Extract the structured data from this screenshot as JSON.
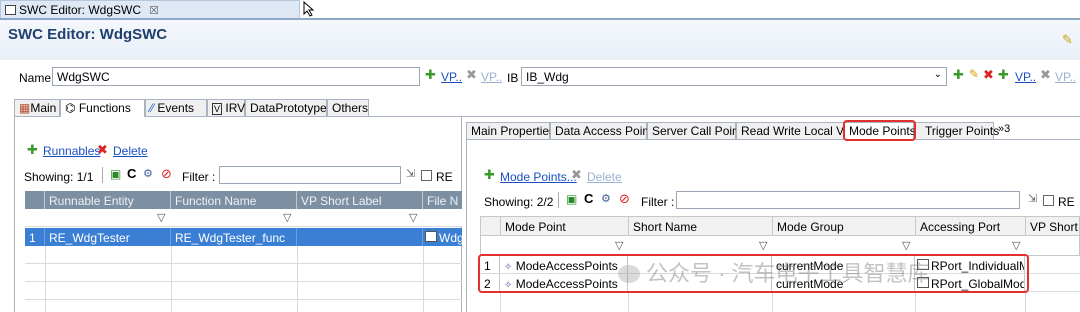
{
  "editor_tab": {
    "title": "SWC Editor: WdgSWC",
    "close": "☒"
  },
  "title": "SWC Editor: WdgSWC",
  "name_row": {
    "name_label": "Name",
    "name_value": "WdgSWC",
    "vp_link": "VP..",
    "vp_link_disabled": "VP..",
    "ib_label": "IB",
    "ib_value": "IB_Wdg",
    "vp_link2": "VP..",
    "vp_link2_disabled": "VP.."
  },
  "main_tabs": [
    "Main",
    "Functions",
    "Events",
    "IRV",
    "DataPrototypes",
    "Others"
  ],
  "left": {
    "runnables_link": "Runnables",
    "delete_link": "Delete",
    "showing": "Showing: 1/1",
    "filter_label": "Filter :",
    "re_label": "RE",
    "columns": [
      "Runnable Entity",
      "Function Name",
      "VP Short Label",
      "File N"
    ],
    "rows": [
      {
        "num": "1",
        "runnable": "RE_WdgTester",
        "function": "RE_WdgTester_func",
        "vp": "",
        "file": "WdgS"
      }
    ]
  },
  "right_tabs": [
    "Main Properties",
    "Data Access Points",
    "Server Call Points",
    "Read Write Local Var",
    "Mode Points",
    "Trigger Points",
    "»3"
  ],
  "right": {
    "mode_points_link": "Mode Points...",
    "delete_link": "Delete",
    "showing": "Showing: 2/2",
    "filter_label": "Filter :",
    "re_label": "RE",
    "columns": [
      "Mode Point",
      "Short Name",
      "Mode Group",
      "Accessing Port",
      "VP Short L"
    ],
    "rows": [
      {
        "num": "1",
        "mode_point": "ModeAccessPoints",
        "short_name": "",
        "mode_group": "currentMode",
        "port": "RPort_IndividualMode"
      },
      {
        "num": "2",
        "mode_point": "ModeAccessPoints",
        "short_name": "",
        "mode_group": "currentMode",
        "port": "RPort_GlobalMode"
      }
    ]
  },
  "watermark": "公众号 · 汽车电子工具智慧库",
  "colors": {
    "selection": "#3b7fd4",
    "highlight_box": "#e03030",
    "header": "#7d8fa3",
    "title": "#1f3f6e"
  }
}
